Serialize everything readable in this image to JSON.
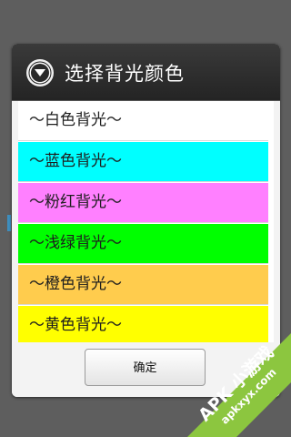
{
  "dialog": {
    "title": "选择背光颜色",
    "icon": "circle-chevron-down-icon",
    "items": [
      {
        "label": "～白色背光～",
        "color": "#ffffff"
      },
      {
        "label": "～蓝色背光～",
        "color": "#00ffff"
      },
      {
        "label": "～粉红背光～",
        "color": "#ff80ff"
      },
      {
        "label": "～浅绿背光～",
        "color": "#00ff00"
      },
      {
        "label": "～橙色背光～",
        "color": "#ffcc4d"
      },
      {
        "label": "～黄色背光～",
        "color": "#ffff00"
      }
    ],
    "ok_label": "确定"
  },
  "watermark": {
    "brand": "APK 小游戏",
    "site": "apkxyx.com",
    "color": "#8cc63f"
  }
}
